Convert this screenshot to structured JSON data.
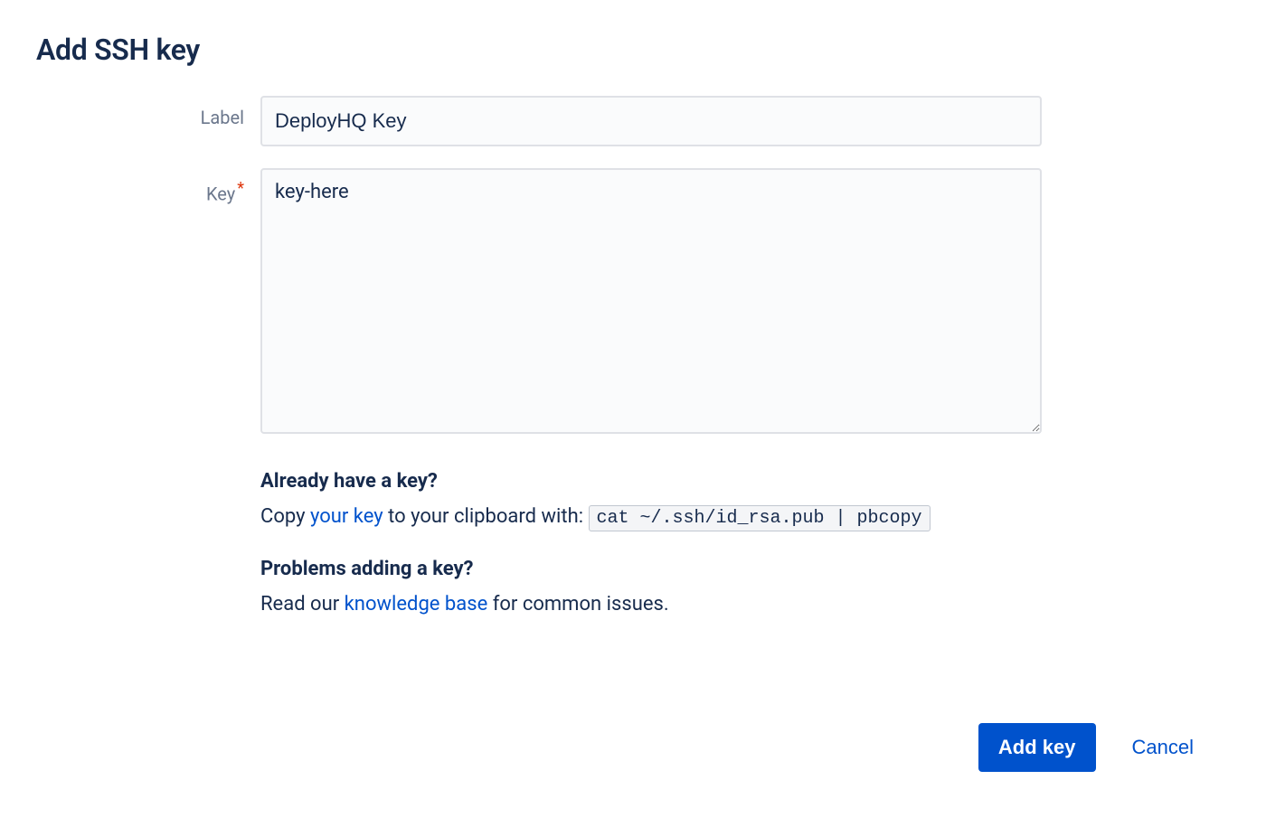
{
  "title": "Add SSH key",
  "form": {
    "label_field": {
      "label": "Label",
      "value": "DeployHQ Key",
      "required": false
    },
    "key_field": {
      "label": "Key",
      "value": "key-here",
      "required": true
    }
  },
  "help": {
    "section1": {
      "heading": "Already have a key?",
      "pre": "Copy ",
      "link": "your key",
      "mid": " to your clipboard with: ",
      "command": "cat ~/.ssh/id_rsa.pub | pbcopy"
    },
    "section2": {
      "heading": "Problems adding a key?",
      "pre": "Read our ",
      "link": "knowledge base",
      "post": " for common issues."
    }
  },
  "buttons": {
    "submit": "Add key",
    "cancel": "Cancel"
  }
}
